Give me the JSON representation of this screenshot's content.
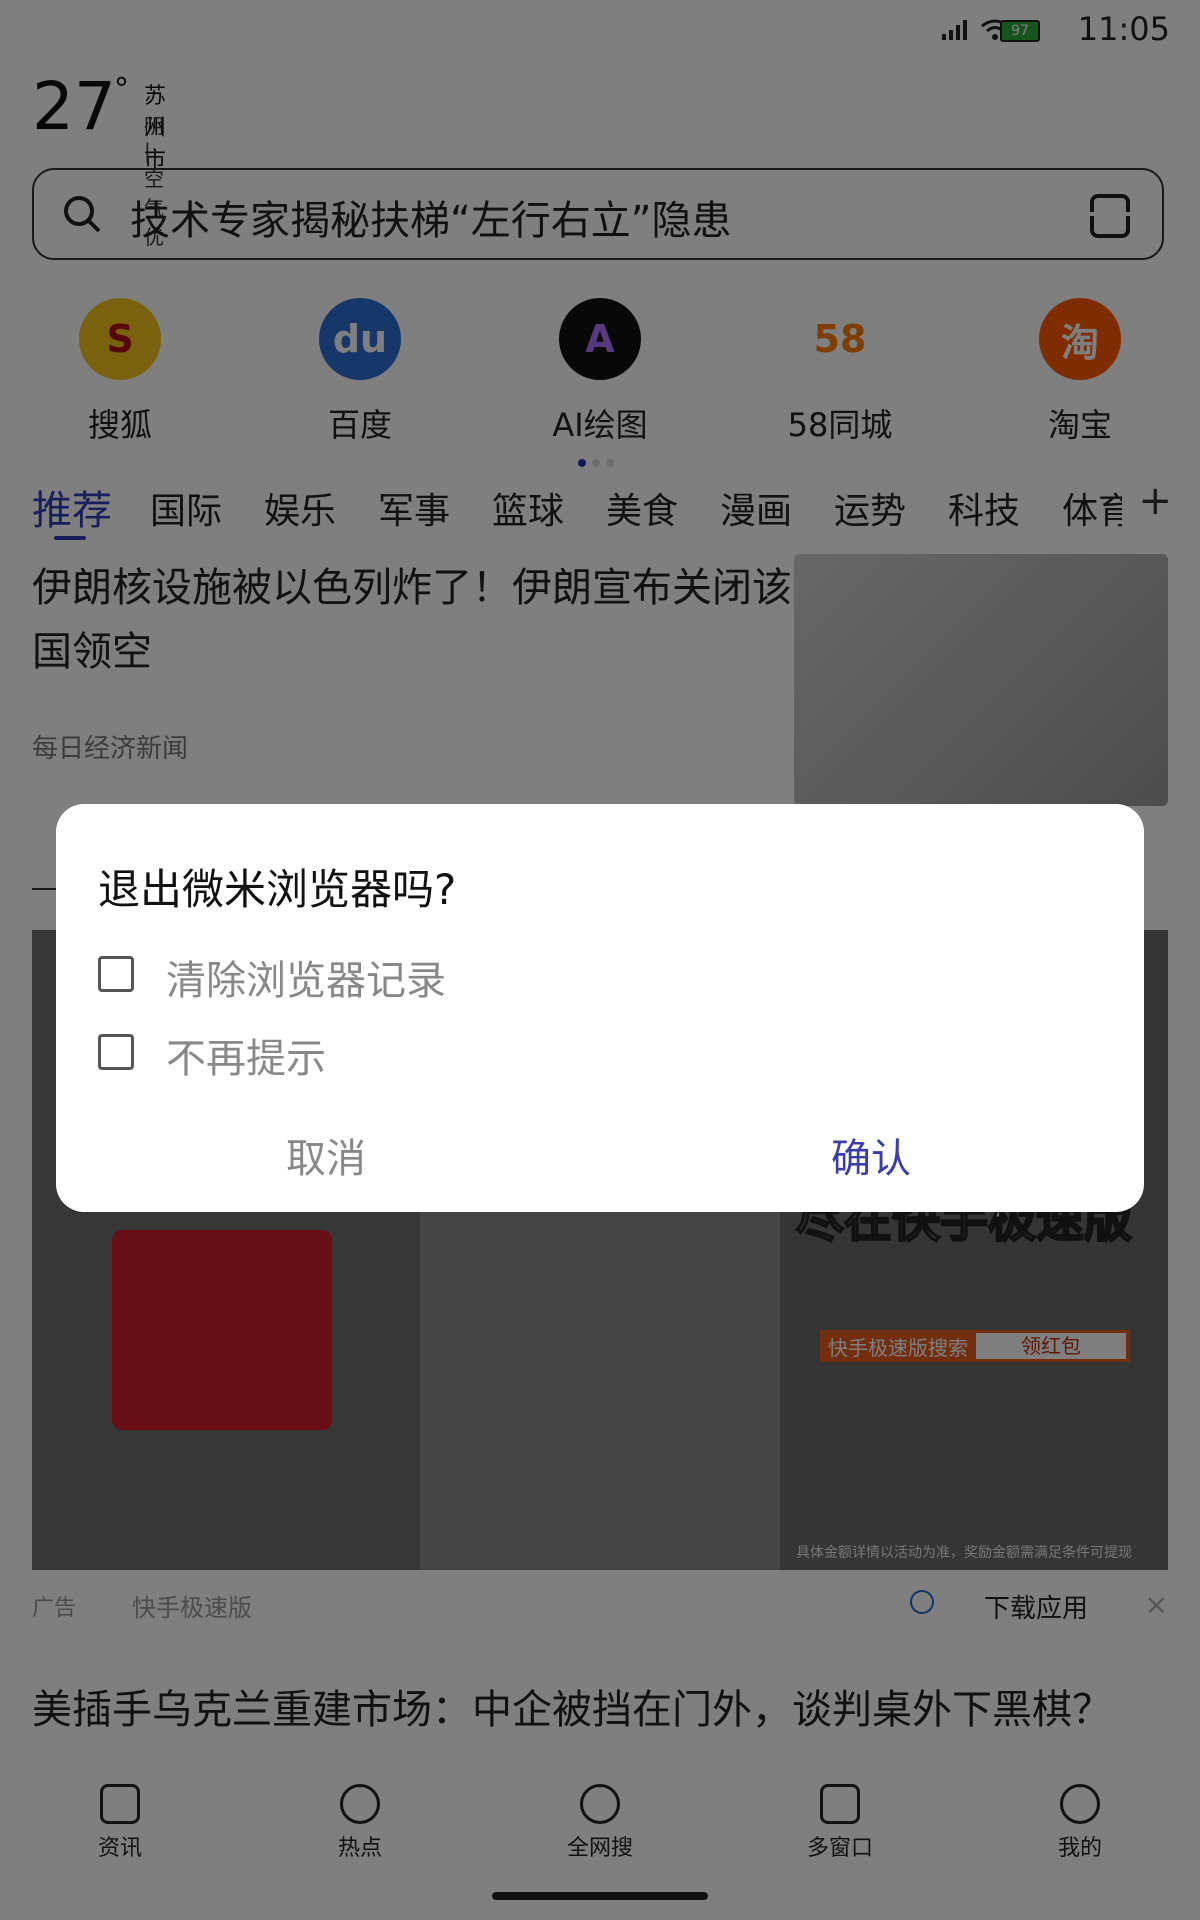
{
  "status_bar": {
    "battery": "97",
    "time": "11:05"
  },
  "weather": {
    "temperature": "27",
    "degree": "°",
    "city": "苏州市",
    "condition": "阴 | 空气优"
  },
  "search": {
    "placeholder": "技术专家揭秘扶梯“左行右立”隐患"
  },
  "apps": [
    {
      "label": "搜狐",
      "glyph": "S",
      "color": "#f3c21b"
    },
    {
      "label": "百度",
      "glyph": "du",
      "color": "#2f6fd6"
    },
    {
      "label": "AI绘图",
      "glyph": "A",
      "color": "#111111"
    },
    {
      "label": "58同城",
      "glyph": "58",
      "color": "#ffffff"
    },
    {
      "label": "淘宝",
      "glyph": "淘",
      "color": "#ff5a00"
    }
  ],
  "tabs": [
    "推荐",
    "国际",
    "娱乐",
    "军事",
    "篮球",
    "美食",
    "漫画",
    "运势",
    "科技",
    "体育"
  ],
  "tabs_more": "+",
  "news": [
    {
      "title": "伊朗核设施被以色列炸了！伊朗宣布关闭该国领空",
      "source": "每日经济新闻"
    },
    {
      "title": "美插手乌克兰重建市场：中企被挡在门外，谈判桌外下黑棋？"
    }
  ],
  "ad": {
    "headline": "尽在快手极速版",
    "search_text": "快手极速版搜索",
    "search_button": "领红包",
    "footnote": "具体金额详情以活动为准，奖励金额需满足条件可提现",
    "tag": "广告",
    "advertiser": "快手极速版",
    "download": "下载应用",
    "close": "×"
  },
  "bottom_nav": [
    "资讯",
    "热点",
    "全网搜",
    "多窗口",
    "我的"
  ],
  "dialog": {
    "title": "退出微米浏览器吗?",
    "option1": "清除浏览器记录",
    "option2": "不再提示",
    "cancel": "取消",
    "confirm": "确认"
  }
}
